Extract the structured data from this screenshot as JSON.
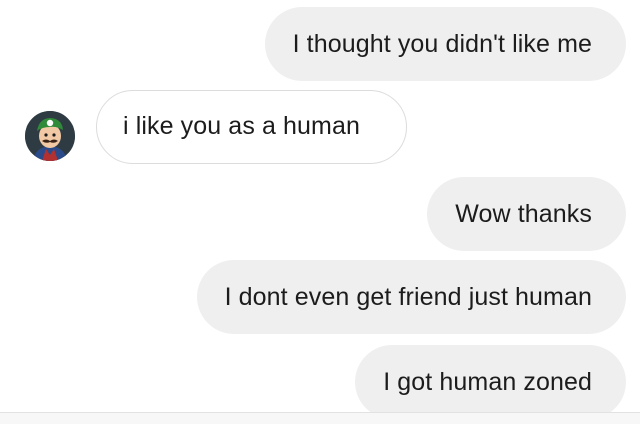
{
  "messages": [
    {
      "direction": "outgoing",
      "text": "I thought you didn't like me"
    },
    {
      "direction": "incoming",
      "text": "i like you as a human",
      "avatar": "cartoon-character-avatar"
    },
    {
      "direction": "outgoing",
      "text": "Wow thanks"
    },
    {
      "direction": "outgoing",
      "text": "I dont even get friend just human"
    },
    {
      "direction": "outgoing",
      "text": "I got human zoned"
    }
  ],
  "colors": {
    "outgoing_bubble": "#efefef",
    "incoming_border": "#dcdcdc",
    "text": "#1c1c1c"
  }
}
